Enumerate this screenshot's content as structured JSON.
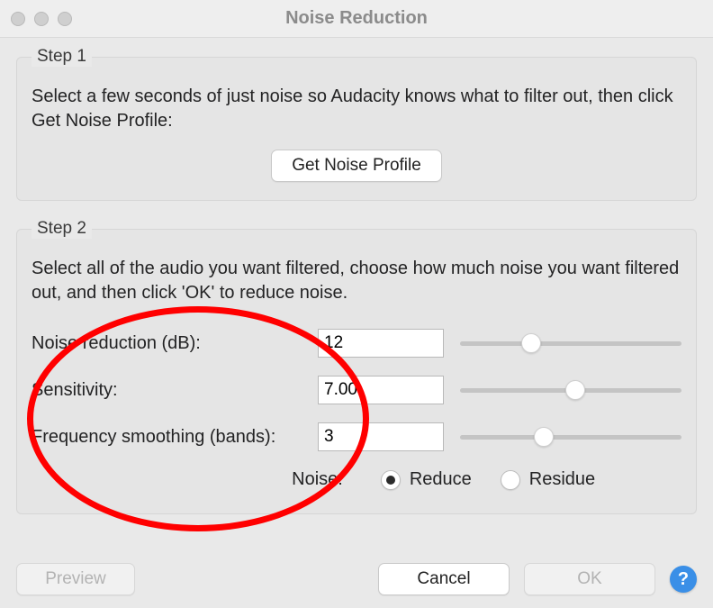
{
  "window": {
    "title": "Noise Reduction"
  },
  "step1": {
    "legend": "Step 1",
    "desc": "Select a few seconds of just noise so Audacity knows what to filter out, then click Get Noise Profile:",
    "button": "Get Noise Profile"
  },
  "step2": {
    "legend": "Step 2",
    "desc": "Select all of the audio you want filtered, choose how much noise you want filtered out, and then click 'OK' to reduce noise.",
    "params": {
      "noise_reduction": {
        "label": "Noise reduction (dB):",
        "value": "12",
        "slider_pct": 32
      },
      "sensitivity": {
        "label": "Sensitivity:",
        "value": "7.00",
        "slider_pct": 52
      },
      "freq_smoothing": {
        "label": "Frequency smoothing (bands):",
        "value": "3",
        "slider_pct": 38
      }
    },
    "noise_row": {
      "label": "Noise:",
      "reduce": "Reduce",
      "residue": "Residue",
      "selected": "reduce"
    }
  },
  "actions": {
    "preview": "Preview",
    "cancel": "Cancel",
    "ok": "OK"
  },
  "help_icon": "?"
}
